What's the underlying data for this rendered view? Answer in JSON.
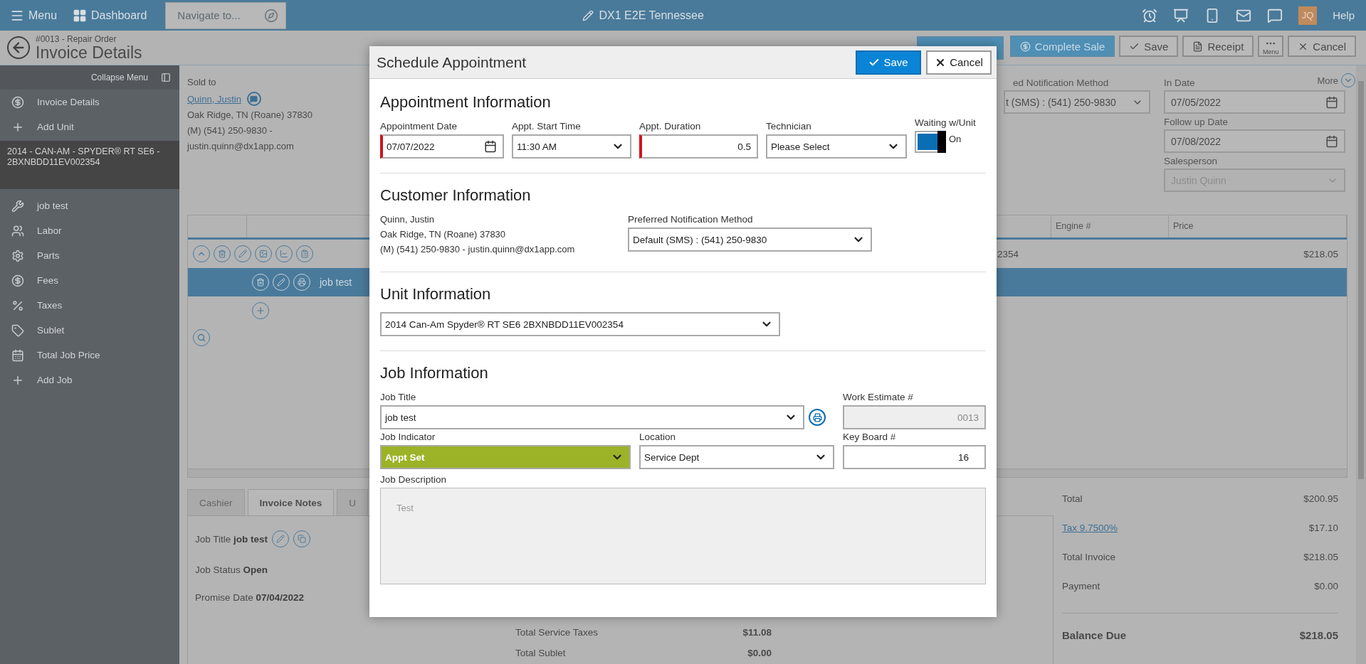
{
  "top_bar": {
    "menu": "Menu",
    "dashboard": "Dashboard",
    "navigate_placeholder": "Navigate to...",
    "title": "DX1 E2E Tennessee",
    "avatar": "JQ",
    "help": "Help"
  },
  "header": {
    "subtitle": "#0013 - Repair Order",
    "title": "Invoice Details",
    "buttons": [
      {
        "label": "Complete Sale",
        "kind": "sale"
      },
      {
        "label": "Save",
        "kind": "save"
      },
      {
        "label": "Receipt",
        "kind": "receipt"
      },
      {
        "label": "Menu",
        "kind": "menu"
      },
      {
        "label": "Cancel",
        "kind": "cancel"
      }
    ]
  },
  "sidebar": {
    "collapse": "Collapse Menu",
    "items_top": [
      {
        "label": "Invoice Details",
        "kind": "dollar"
      },
      {
        "label": "Add Unit",
        "kind": "plus"
      }
    ],
    "unit": "2014 - CAN-AM - SPYDER® RT SE6 - 2BXNBDD11EV002354",
    "items_job": [
      {
        "label": "job test",
        "kind": "wrench"
      },
      {
        "label": "Labor",
        "kind": "people"
      },
      {
        "label": "Parts",
        "kind": "gear"
      },
      {
        "label": "Fees",
        "kind": "dollar"
      },
      {
        "label": "Taxes",
        "kind": "tax"
      },
      {
        "label": "Sublet",
        "kind": "tag"
      },
      {
        "label": "Total Job Price",
        "kind": "calendar"
      },
      {
        "label": "Add Job",
        "kind": "plus"
      }
    ]
  },
  "customer": {
    "sold_to": "Sold to",
    "name": "Quinn, Justin",
    "address": "Oak Ridge, TN (Roane) 37830",
    "phone": "(M) (541) 250-9830 -",
    "email": "justin.quinn@dx1app.com"
  },
  "details": {
    "notification_label": "ed Notification Method",
    "notification": "t (SMS) : (541) 250-9830",
    "more": "More",
    "in_date_label": "In Date",
    "in_date": "07/05/2022",
    "followup_label": "Follow up Date",
    "followup": "07/08/2022",
    "salesperson_label": "Salesperson",
    "salesperson": "Justin Quinn",
    "salesperson_disabled": true
  },
  "table": {
    "columns": [
      {
        "label": "Engine #"
      },
      {
        "label": "Price"
      }
    ],
    "unit_row": {
      "vin": "2354",
      "price": "$218.05"
    },
    "job_row": {
      "title": "job test",
      "selected": true
    }
  },
  "bottom": {
    "tabs": [
      {
        "label": "Cashier",
        "selected": false
      },
      {
        "label": "Invoice Notes",
        "selected": true
      },
      {
        "label": "U",
        "selected": false
      }
    ],
    "notes": [
      {
        "text": "Job Title **job test**",
        "kind": "title"
      },
      {
        "text": "Job Status **Open**",
        "kind": "plain"
      },
      {
        "text": "Promise Date **07/04/2022**",
        "kind": "plain"
      }
    ],
    "job_totals": [
      {
        "label": "Total Service Taxes",
        "value": "$11.08"
      },
      {
        "label": "Total Sublet",
        "value": "$0.00"
      }
    ],
    "totals": [
      {
        "label": "Total",
        "value": "$200.95",
        "kind": "plain"
      },
      {
        "label": "Tax 9.7500%",
        "value": "$17.10",
        "kind": "link"
      },
      {
        "label": "Total Invoice",
        "value": "$218.05",
        "kind": "plain"
      },
      {
        "label": "Payment",
        "value": "$0.00",
        "kind": "plain"
      },
      {
        "label": "Balance Due",
        "value": "$218.05",
        "kind": "grand"
      }
    ]
  },
  "modal": {
    "title": "Schedule Appointment",
    "save": "Save",
    "cancel": "Cancel",
    "appointment": {
      "heading": "Appointment Information",
      "fields": [
        {
          "label": "Appointment Date",
          "value": "07/07/2022",
          "kind": "date",
          "required": true
        },
        {
          "label": "Appt. Start Time",
          "value": "11:30 AM",
          "kind": "select",
          "required": false
        },
        {
          "label": "Appt. Duration",
          "value": "0.5",
          "kind": "number",
          "required": true
        },
        {
          "label": "Technician",
          "value": "Please Select",
          "kind": "select",
          "required": false
        }
      ],
      "waiting": {
        "label": "Waiting w/Unit",
        "on": true,
        "text": "On"
      }
    },
    "customer": {
      "heading": "Customer Information",
      "name": "Quinn, Justin",
      "address": "Oak Ridge, TN (Roane) 37830",
      "contact": "(M) (541) 250-9830 - justin.quinn@dx1app.com",
      "notification_label": "Preferred Notification Method",
      "notification": "Default (SMS) : (541) 250-9830"
    },
    "unit": {
      "heading": "Unit Information",
      "unit": "2014 Can-Am Spyder® RT SE6 2BXNBDD11EV002354"
    },
    "job": {
      "heading": "Job Information",
      "title_label": "Job Title",
      "title": "job test",
      "estimate_label": "Work Estimate #",
      "estimate": "0013",
      "estimate_disabled": true,
      "indicator_label": "Job Indicator",
      "indicator": "Appt Set",
      "location_label": "Location",
      "location": "Service Dept",
      "keyboard_label": "Key Board #",
      "keyboard": "16",
      "description_label": "Job Description",
      "description": "Test"
    }
  }
}
